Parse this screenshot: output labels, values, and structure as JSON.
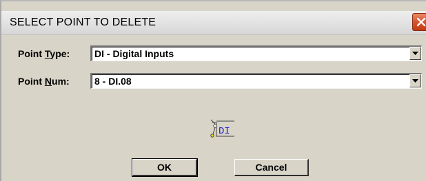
{
  "dialog": {
    "title": "SELECT POINT TO DELETE",
    "close_icon": "close-icon",
    "close_color": "#d4542e"
  },
  "fields": {
    "point_type": {
      "label_prefix": "Point ",
      "label_accel": "T",
      "label_suffix": "ype:",
      "value": "DI - Digital Inputs"
    },
    "point_num": {
      "label_prefix": "Point ",
      "label_accel": "N",
      "label_suffix": "um:",
      "value": "8 - DI.08"
    }
  },
  "icon": {
    "name": "digital-input-icon",
    "text": "DI"
  },
  "buttons": {
    "ok_label": "OK",
    "cancel_label": "Cancel"
  }
}
